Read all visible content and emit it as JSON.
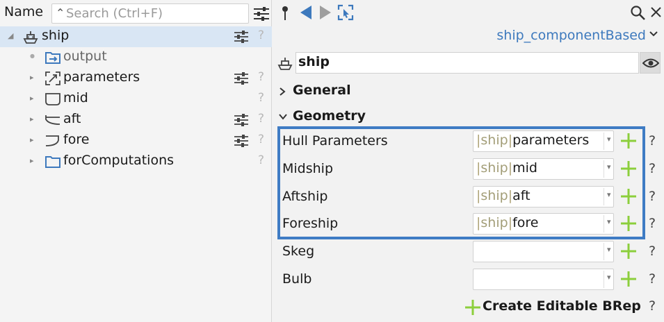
{
  "tree_panel": {
    "column_header": "Name",
    "search": {
      "placeholder": "Search (Ctrl+F)",
      "value": ""
    },
    "items": [
      {
        "label": "ship",
        "icon": "ship-icon",
        "selected": true,
        "sliders": true,
        "help": "?"
      },
      {
        "label": "output",
        "icon": "output-icon",
        "muted": true,
        "sliders": false,
        "help": ""
      },
      {
        "label": "parameters",
        "icon": "parameters-icon",
        "sliders": true,
        "help": "?"
      },
      {
        "label": "mid",
        "icon": "mid-section-icon",
        "sliders": false,
        "help": "?"
      },
      {
        "label": "aft",
        "icon": "aft-section-icon",
        "sliders": true,
        "help": "?"
      },
      {
        "label": "fore",
        "icon": "fore-section-icon",
        "sliders": true,
        "help": "?"
      },
      {
        "label": "forComputations",
        "icon": "folder-icon",
        "sliders": false,
        "help": "?"
      }
    ]
  },
  "properties_panel": {
    "template_name": "ship_componentBased",
    "object_name": "ship",
    "groups": {
      "general": "General",
      "geometry": "Geometry"
    },
    "rows": [
      {
        "label": "Hull Parameters",
        "path": "ship",
        "value": "parameters",
        "help": "?"
      },
      {
        "label": "Midship",
        "path": "ship",
        "value": "mid",
        "help": "?"
      },
      {
        "label": "Aftship",
        "path": "ship",
        "value": "aft",
        "help": "?"
      },
      {
        "label": "Foreship",
        "path": "ship",
        "value": "fore",
        "help": "?"
      },
      {
        "label": "Skeg",
        "path": "",
        "value": "",
        "help": "?"
      },
      {
        "label": "Bulb",
        "path": "",
        "value": "",
        "help": "?"
      }
    ],
    "separator": "|",
    "create_button": "Create Editable BRep",
    "create_help": "?"
  },
  "colors": {
    "accent_blue": "#3d79bd",
    "highlight_frame": "#3f7cc4",
    "plus_green": "#8ccf3c",
    "selection": "#d9e6f4",
    "path_text": "#a39e78"
  }
}
